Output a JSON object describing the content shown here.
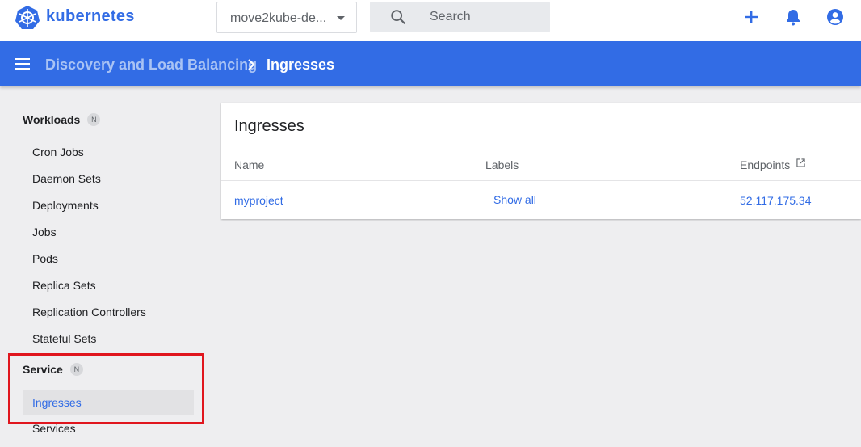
{
  "brand": {
    "name": "kubernetes",
    "color": "#326ce5",
    "logo_icon": "kubernetes-helm-icon"
  },
  "namespace_selector": {
    "value": "move2kube-de..."
  },
  "search": {
    "placeholder": "Search",
    "icon": "search-icon"
  },
  "top_actions": [
    "add-icon",
    "notifications-bell-icon",
    "account-circle-icon"
  ],
  "breadcrumb": {
    "parent": "Discovery and Load Balancing",
    "current": "Ingresses"
  },
  "sidebar": {
    "workloads": {
      "title": "Workloads",
      "badge": "N",
      "items": [
        "Cron Jobs",
        "Daemon Sets",
        "Deployments",
        "Jobs",
        "Pods",
        "Replica Sets",
        "Replication Controllers",
        "Stateful Sets"
      ]
    },
    "service": {
      "title": "Service",
      "badge": "N",
      "items": [
        "Ingresses",
        "Services"
      ],
      "active": "Ingresses"
    }
  },
  "card": {
    "title": "Ingresses",
    "columns": {
      "name": "Name",
      "labels": "Labels",
      "endpoints": "Endpoints"
    },
    "rows": [
      {
        "name": "myproject",
        "labels": "Show all",
        "endpoints": "52.117.175.34"
      }
    ]
  },
  "colors": {
    "header_blue": "#326ce5",
    "highlight_red": "#e0161e",
    "background": "#eeeef0"
  }
}
